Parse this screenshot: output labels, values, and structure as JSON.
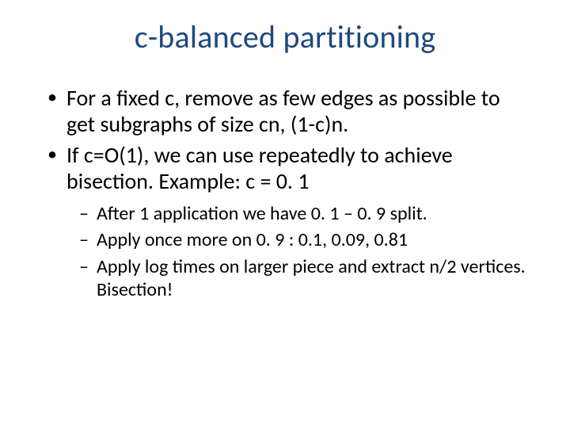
{
  "title": "c-balanced partitioning",
  "bullets": [
    {
      "text": "For a fixed c, remove as few edges as possible to get subgraphs of size cn, (1-c)n."
    },
    {
      "text": "If c=O(1), we can use repeatedly to achieve bisection. Example: c = 0. 1"
    }
  ],
  "subbullets": [
    {
      "text": "After 1 application we have 0. 1 – 0. 9 split."
    },
    {
      "text": "Apply once more on 0. 9 : 0.1, 0.09, 0.81"
    },
    {
      "text": "Apply log times on larger piece and extract n/2 vertices.  Bisection!"
    }
  ]
}
